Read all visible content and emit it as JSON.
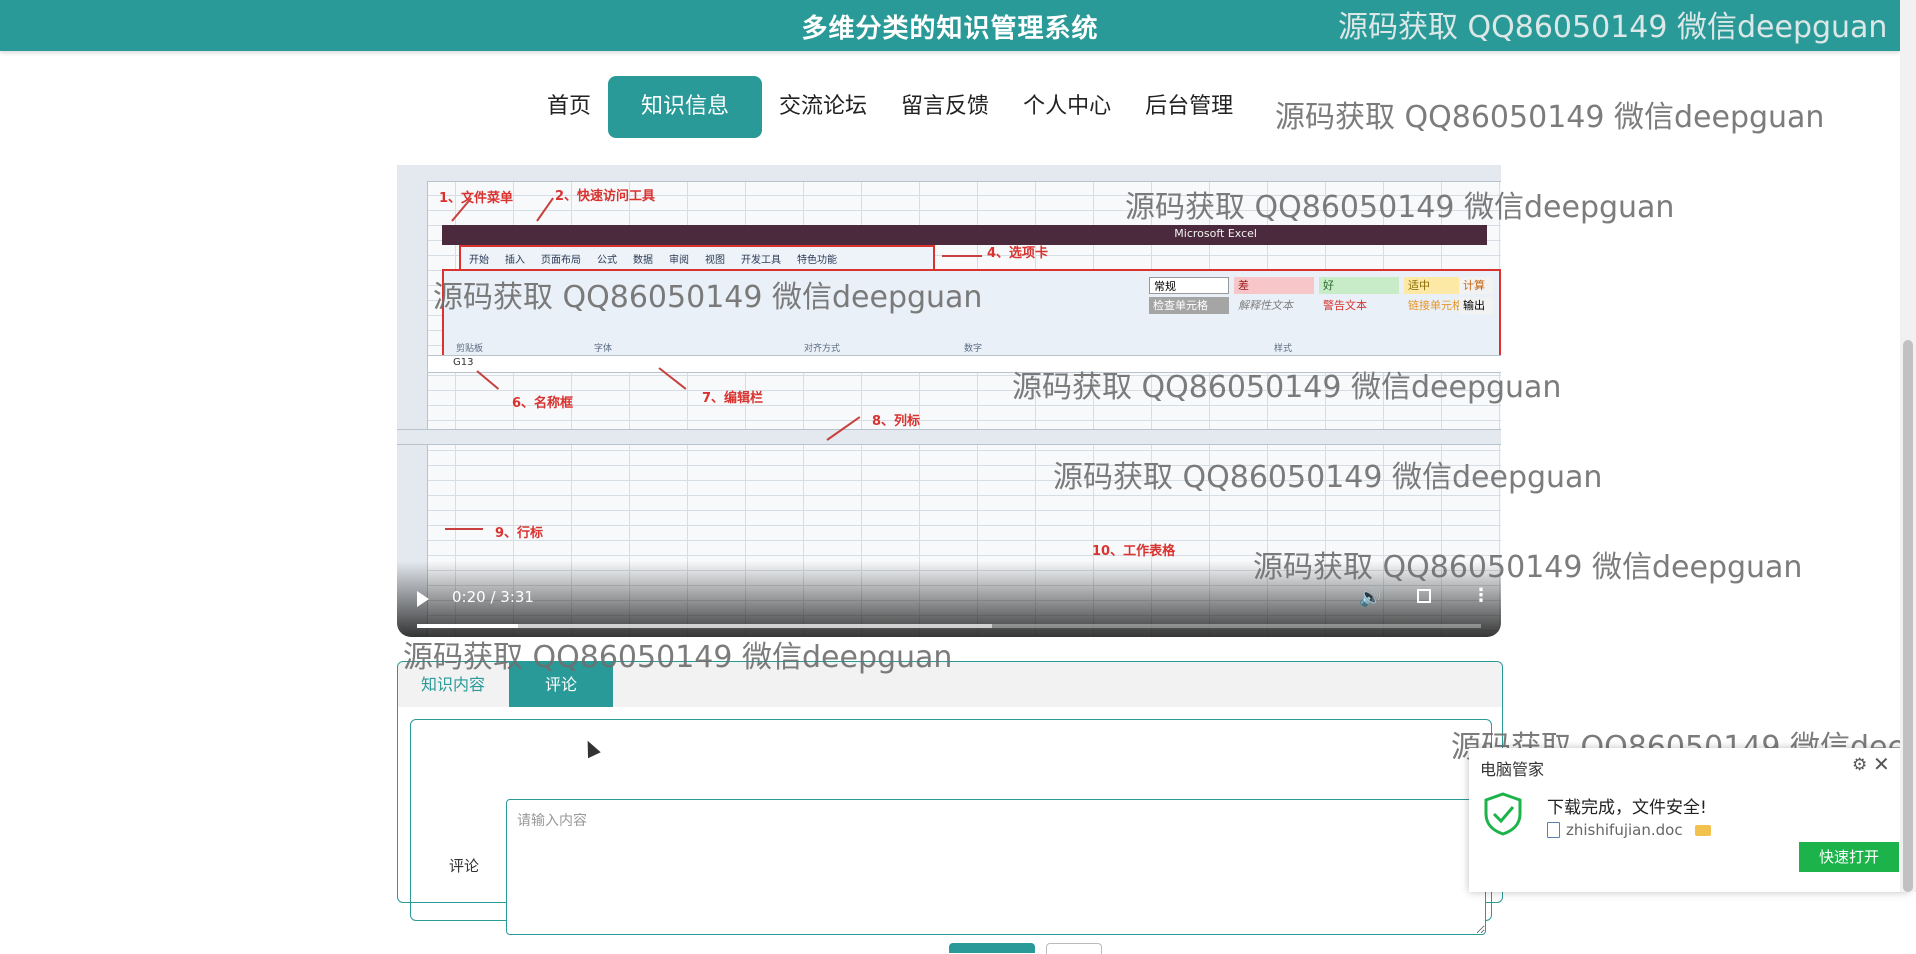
{
  "header": {
    "title": "多维分类的知识管理系统"
  },
  "watermark_text": "源码获取 QQ86050149 微信deepguan",
  "nav": {
    "items": [
      {
        "label": "首页"
      },
      {
        "label": "知识信息"
      },
      {
        "label": "交流论坛"
      },
      {
        "label": "留言反馈"
      },
      {
        "label": "个人中心"
      },
      {
        "label": "后台管理"
      }
    ],
    "active_index": 1
  },
  "video": {
    "time": "0:20 / 3:31",
    "progress": 0.095,
    "buffered": 0.54,
    "excel": {
      "window_title": "Microsoft Excel",
      "tabs": [
        "开始",
        "插入",
        "页面布局",
        "公式",
        "数据",
        "审阅",
        "视图",
        "开发工具",
        "特色功能"
      ],
      "name_box": "G13",
      "styles": [
        "常规",
        "差",
        "好",
        "适中",
        "计算",
        "检查单元格",
        "解释性文本",
        "警告文本",
        "链接单元格",
        "输出"
      ],
      "group_labels": [
        "剪贴板",
        "字体",
        "对齐方式",
        "数字",
        "样式"
      ],
      "labels": [
        "1、文件菜单",
        "2、快速访问工具",
        "4、选项卡",
        "6、名称框",
        "7、编辑栏",
        "8、列标",
        "9、行标",
        "10、工作表格"
      ]
    }
  },
  "tabs": [
    {
      "label": "知识内容"
    },
    {
      "label": "评论"
    }
  ],
  "comment_form": {
    "label": "评论",
    "placeholder": "请输入内容"
  },
  "popup": {
    "title": "电脑管家",
    "message": "下载完成，文件安全!",
    "filename": "zhishifujian.doc",
    "open_button": "快速打开"
  },
  "colors": {
    "primary": "#2a9a98",
    "popup_button": "#1db34b"
  }
}
